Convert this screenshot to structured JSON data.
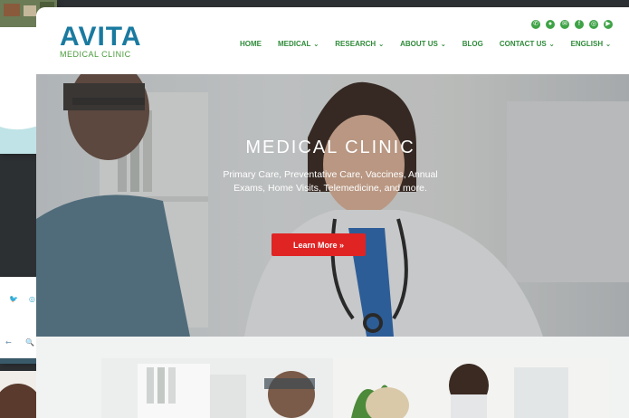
{
  "logo": {
    "main": "AVITA",
    "sub": "MEDICAL CLINIC"
  },
  "social_icons": [
    "phone-icon",
    "map-pin-icon",
    "mail-icon",
    "facebook-icon",
    "instagram-icon",
    "youtube-icon"
  ],
  "nav": [
    {
      "label": "HOME",
      "dropdown": false,
      "active": true
    },
    {
      "label": "MEDICAL",
      "dropdown": true
    },
    {
      "label": "RESEARCH",
      "dropdown": true
    },
    {
      "label": "ABOUT US",
      "dropdown": true
    },
    {
      "label": "BLOG",
      "dropdown": false
    },
    {
      "label": "CONTACT US",
      "dropdown": true
    },
    {
      "label": "ENGLISH",
      "dropdown": true
    }
  ],
  "hero": {
    "title": "MEDICAL CLINIC",
    "text": "Primary Care, Preventative Care, Vaccines, Annual Exams, Home Visits, Telemedicine, and more.",
    "button": "Learn More »"
  },
  "colors": {
    "brand_blue": "#1a7aa0",
    "brand_green": "#3ea346",
    "cta_red": "#e02424"
  }
}
